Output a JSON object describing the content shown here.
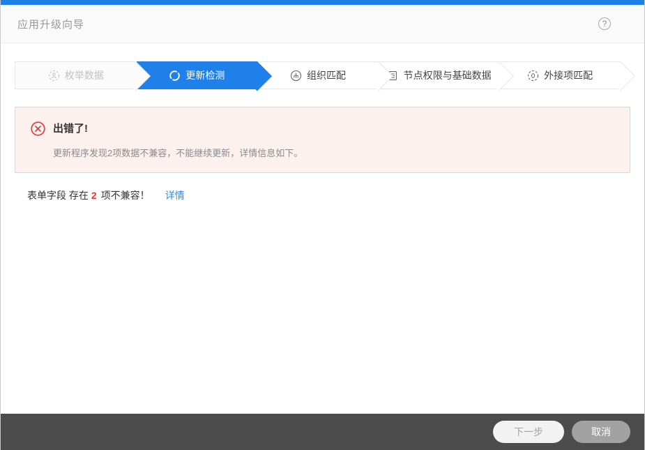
{
  "window": {
    "title": "应用升级向导"
  },
  "header": {
    "help_icon": "?"
  },
  "steps": [
    {
      "label": "枚举数据",
      "icon": "enumerate-icon",
      "state": "done"
    },
    {
      "label": "更新检测",
      "icon": "refresh-icon",
      "state": "active"
    },
    {
      "label": "组织匹配",
      "icon": "org-chart-icon",
      "state": "pending"
    },
    {
      "label": "节点权限与基础数据",
      "icon": "document-list-icon",
      "state": "pending"
    },
    {
      "label": "外接项匹配",
      "icon": "external-item-icon",
      "state": "pending"
    }
  ],
  "error": {
    "title": "出错了!",
    "message": "更新程序发现2项数据不兼容，不能继续更新，详情信息如下。"
  },
  "result": {
    "prefix": "表单字段 存在",
    "count": "2",
    "suffix": "项不兼容！",
    "link": "详情"
  },
  "footer": {
    "next": "下一步",
    "cancel": "取消"
  },
  "colors": {
    "accent_blue": "#1e80e8",
    "error_red": "#e6392f",
    "error_bg": "#fdf1f0",
    "error_border": "#f3cdc9",
    "link_blue": "#2b8ced",
    "footer_gray": "#4c4c4c"
  }
}
